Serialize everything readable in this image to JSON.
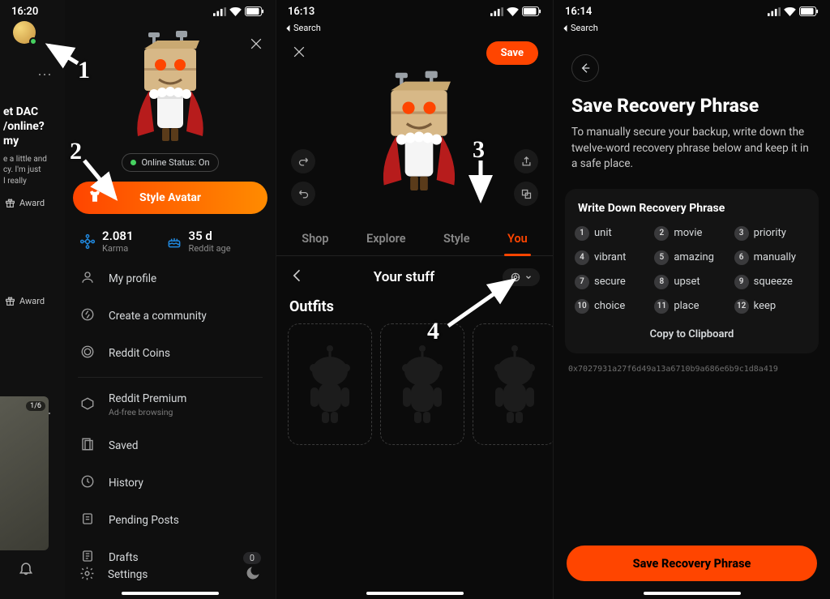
{
  "annotations": {
    "n1": "1",
    "n2": "2",
    "n3": "3",
    "n4": "4"
  },
  "p1": {
    "status_time": "16:20",
    "left": {
      "title": "et DAC\n/online?\nmy",
      "blurb": "e a little and\ncy. I'm just\nI really",
      "award": "Award",
      "thumb_badge": "1/6"
    },
    "online": "Online Status: On",
    "style_button": "Style Avatar",
    "stats": {
      "karma_val": "2.081",
      "karma_lbl": "Karma",
      "age_val": "35 d",
      "age_lbl": "Reddit age"
    },
    "menu": {
      "profile": "My profile",
      "create": "Create a community",
      "coins": "Reddit Coins",
      "premium": "Reddit Premium",
      "premium_sub": "Ad-free browsing",
      "saved": "Saved",
      "history": "History",
      "pending": "Pending Posts",
      "drafts": "Drafts",
      "drafts_count": "0"
    },
    "settings": "Settings"
  },
  "p2": {
    "status_time": "16:13",
    "back_search": "Search",
    "save": "Save",
    "tabs": {
      "shop": "Shop",
      "explore": "Explore",
      "style": "Style",
      "you": "You"
    },
    "your_stuff": "Your stuff",
    "outfits": "Outfits"
  },
  "p3": {
    "status_time": "16:14",
    "back_search": "Search",
    "title": "Save Recovery Phrase",
    "desc": "To manually secure your backup, write down the twelve-word recovery phrase below and keep it in a safe place.",
    "card_hdr": "Write Down Recovery Phrase",
    "words": [
      "unit",
      "movie",
      "priority",
      "vibrant",
      "amazing",
      "manually",
      "secure",
      "upset",
      "squeeze",
      "choice",
      "place",
      "keep"
    ],
    "copy": "Copy to Clipboard",
    "hash": "0x7027931a27f6d49a13a6710b9a686e6b9c1d8a419",
    "save_btn": "Save Recovery Phrase"
  }
}
